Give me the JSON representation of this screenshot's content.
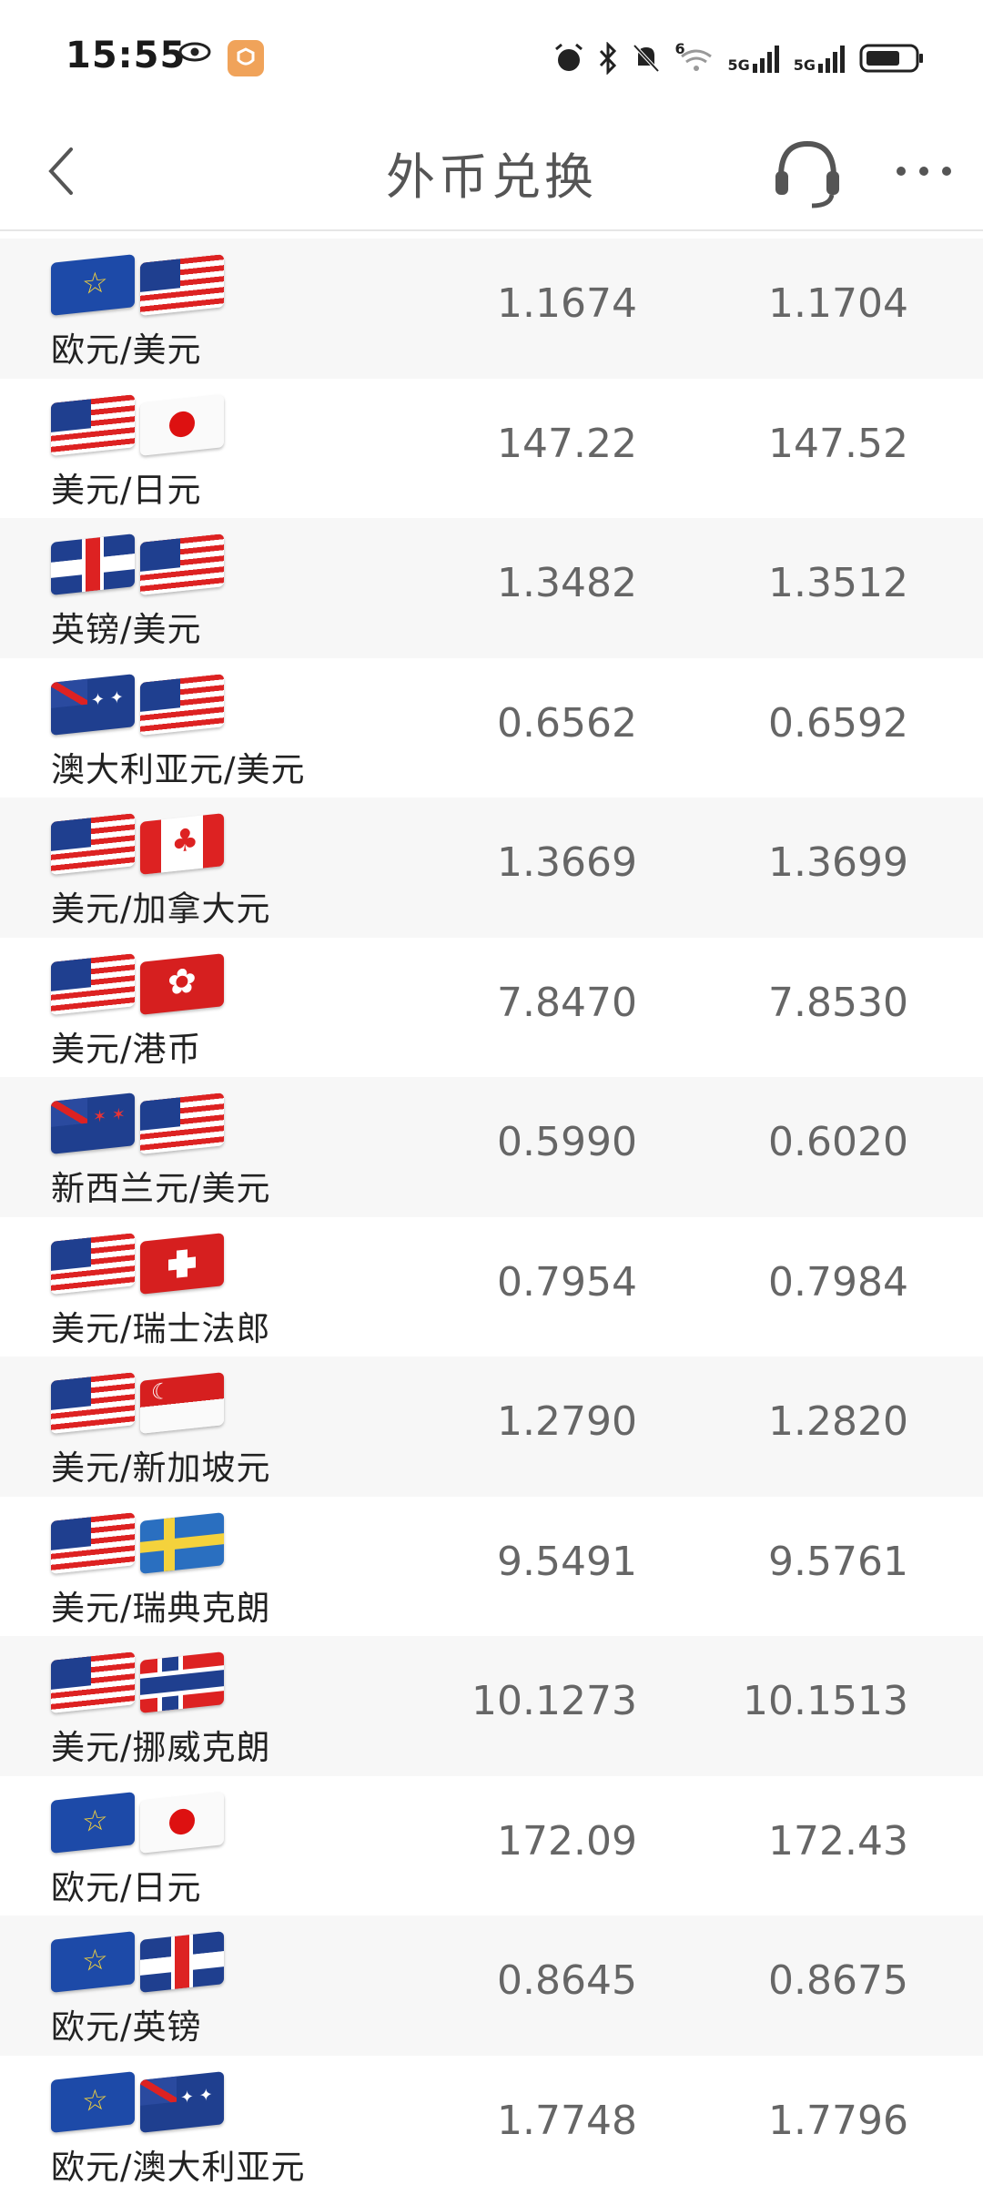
{
  "status_bar": {
    "time": "15:55",
    "icons": [
      "eye-icon",
      "app-badge-icon",
      "alarm-icon",
      "bluetooth-icon",
      "mute-icon",
      "wifi-icon",
      "signal-5g-icon",
      "signal-5g-icon",
      "battery-icon"
    ],
    "wifi_label": "6",
    "net1": "5G",
    "net2": "5G"
  },
  "header": {
    "title": "外币兑换",
    "back_icon": "chevron-left-icon",
    "service_icon": "headset-icon",
    "more_icon": "more-dots-icon"
  },
  "colors": {
    "background": "#ffffff",
    "row_alt": "#f7f7f7",
    "text": "#666666"
  },
  "rows": [
    {
      "pair": "欧元/美元",
      "bid": "1.1674",
      "ask": "1.1704",
      "flags": [
        "eu",
        "us"
      ]
    },
    {
      "pair": "美元/日元",
      "bid": "147.22",
      "ask": "147.52",
      "flags": [
        "us",
        "jp"
      ]
    },
    {
      "pair": "英镑/美元",
      "bid": "1.3482",
      "ask": "1.3512",
      "flags": [
        "gb",
        "us"
      ]
    },
    {
      "pair": "澳大利亚元/美元",
      "bid": "0.6562",
      "ask": "0.6592",
      "flags": [
        "au",
        "us"
      ]
    },
    {
      "pair": "美元/加拿大元",
      "bid": "1.3669",
      "ask": "1.3699",
      "flags": [
        "us",
        "ca"
      ]
    },
    {
      "pair": "美元/港币",
      "bid": "7.8470",
      "ask": "7.8530",
      "flags": [
        "us",
        "hk"
      ]
    },
    {
      "pair": "新西兰元/美元",
      "bid": "0.5990",
      "ask": "0.6020",
      "flags": [
        "nz",
        "us"
      ]
    },
    {
      "pair": "美元/瑞士法郎",
      "bid": "0.7954",
      "ask": "0.7984",
      "flags": [
        "us",
        "ch"
      ]
    },
    {
      "pair": "美元/新加坡元",
      "bid": "1.2790",
      "ask": "1.2820",
      "flags": [
        "us",
        "sg"
      ]
    },
    {
      "pair": "美元/瑞典克朗",
      "bid": "9.5491",
      "ask": "9.5761",
      "flags": [
        "us",
        "se"
      ]
    },
    {
      "pair": "美元/挪威克朗",
      "bid": "10.1273",
      "ask": "10.1513",
      "flags": [
        "us",
        "no"
      ]
    },
    {
      "pair": "欧元/日元",
      "bid": "172.09",
      "ask": "172.43",
      "flags": [
        "eu",
        "jp"
      ]
    },
    {
      "pair": "欧元/英镑",
      "bid": "0.8645",
      "ask": "0.8675",
      "flags": [
        "eu",
        "gb"
      ]
    },
    {
      "pair": "欧元/澳大利亚元",
      "bid": "1.7748",
      "ask": "1.7796",
      "flags": [
        "eu",
        "au"
      ]
    }
  ]
}
